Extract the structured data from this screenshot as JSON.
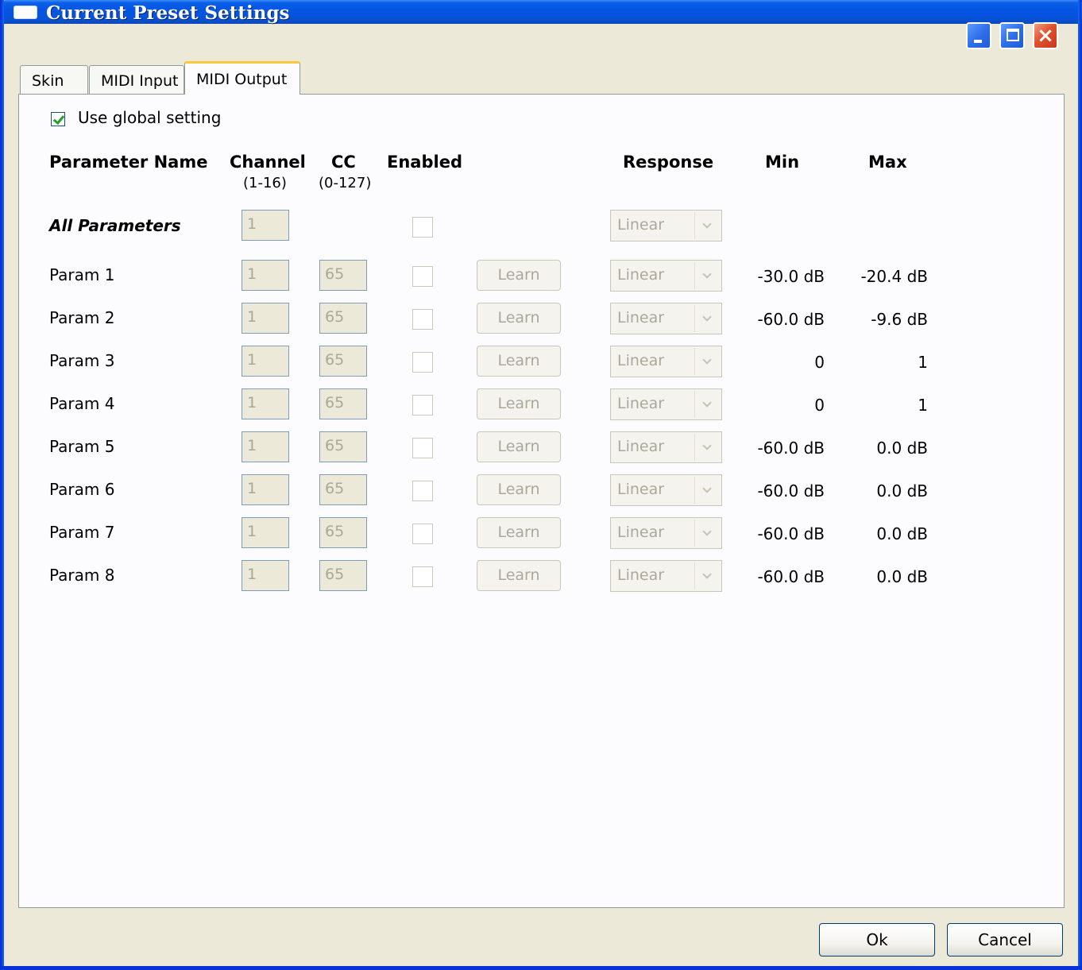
{
  "window": {
    "title": "Current Preset Settings"
  },
  "tabs": [
    {
      "label": "Skin"
    },
    {
      "label": "MIDI Input"
    },
    {
      "label": "MIDI Output",
      "selected": true
    }
  ],
  "global": {
    "label": "Use global setting",
    "checked": true
  },
  "headers": {
    "name": "Parameter Name",
    "channel": "Channel",
    "channel_range": "(1-16)",
    "cc": "CC",
    "cc_range": "(0-127)",
    "enabled": "Enabled",
    "response": "Response",
    "min": "Min",
    "max": "Max"
  },
  "all_params": {
    "label": "All Parameters",
    "channel": "1",
    "response": "Linear"
  },
  "learn_label": "Learn",
  "params": [
    {
      "name": "Param 1",
      "channel": "1",
      "cc": "65",
      "response": "Linear",
      "min": "-30.0 dB",
      "max": "-20.4 dB"
    },
    {
      "name": "Param 2",
      "channel": "1",
      "cc": "65",
      "response": "Linear",
      "min": "-60.0 dB",
      "max": "-9.6 dB"
    },
    {
      "name": "Param 3",
      "channel": "1",
      "cc": "65",
      "response": "Linear",
      "min": "0",
      "max": "1"
    },
    {
      "name": "Param 4",
      "channel": "1",
      "cc": "65",
      "response": "Linear",
      "min": "0",
      "max": "1"
    },
    {
      "name": "Param 5",
      "channel": "1",
      "cc": "65",
      "response": "Linear",
      "min": "-60.0 dB",
      "max": "0.0 dB"
    },
    {
      "name": "Param 6",
      "channel": "1",
      "cc": "65",
      "response": "Linear",
      "min": "-60.0 dB",
      "max": "0.0 dB"
    },
    {
      "name": "Param 7",
      "channel": "1",
      "cc": "65",
      "response": "Linear",
      "min": "-60.0 dB",
      "max": "0.0 dB"
    },
    {
      "name": "Param 8",
      "channel": "1",
      "cc": "65",
      "response": "Linear",
      "min": "-60.0 dB",
      "max": "0.0 dB"
    }
  ],
  "buttons": {
    "ok": "Ok",
    "cancel": "Cancel"
  }
}
